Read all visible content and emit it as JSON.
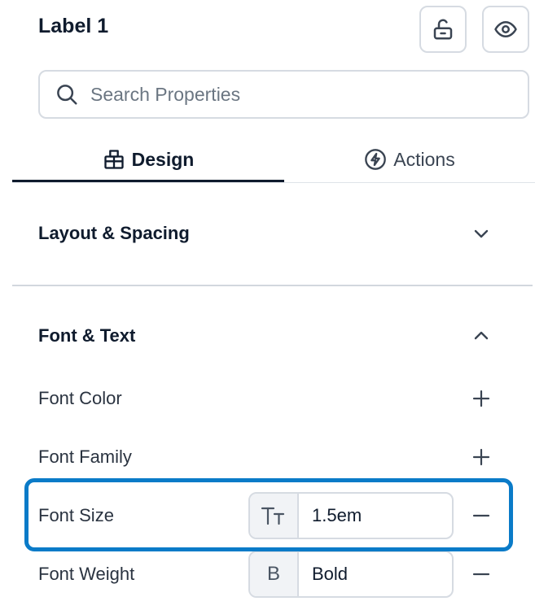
{
  "header": {
    "title": "Label 1",
    "lock_icon": "unlock-icon",
    "visibility_icon": "eye-icon"
  },
  "search": {
    "placeholder": "Search Properties",
    "value": ""
  },
  "tabs": [
    {
      "label": "Design",
      "icon": "design-icon",
      "active": true
    },
    {
      "label": "Actions",
      "icon": "lightning-icon",
      "active": false
    }
  ],
  "sections": {
    "layout": {
      "title": "Layout & Spacing",
      "expanded": false
    },
    "font": {
      "title": "Font & Text",
      "expanded": true,
      "properties": [
        {
          "label": "Font Color",
          "action": "add"
        },
        {
          "label": "Font Family",
          "action": "add"
        },
        {
          "label": "Font Size",
          "action": "remove",
          "prefix_icon": "text-size-icon",
          "value": "1.5em",
          "highlighted": true
        },
        {
          "label": "Font Weight",
          "action": "remove",
          "prefix_icon": "bold-icon",
          "prefix_text": "B",
          "value": "Bold"
        }
      ]
    }
  },
  "colors": {
    "highlight": "#0a7bc8",
    "text_primary": "#0f1b2d",
    "border": "#d6dbe2"
  }
}
